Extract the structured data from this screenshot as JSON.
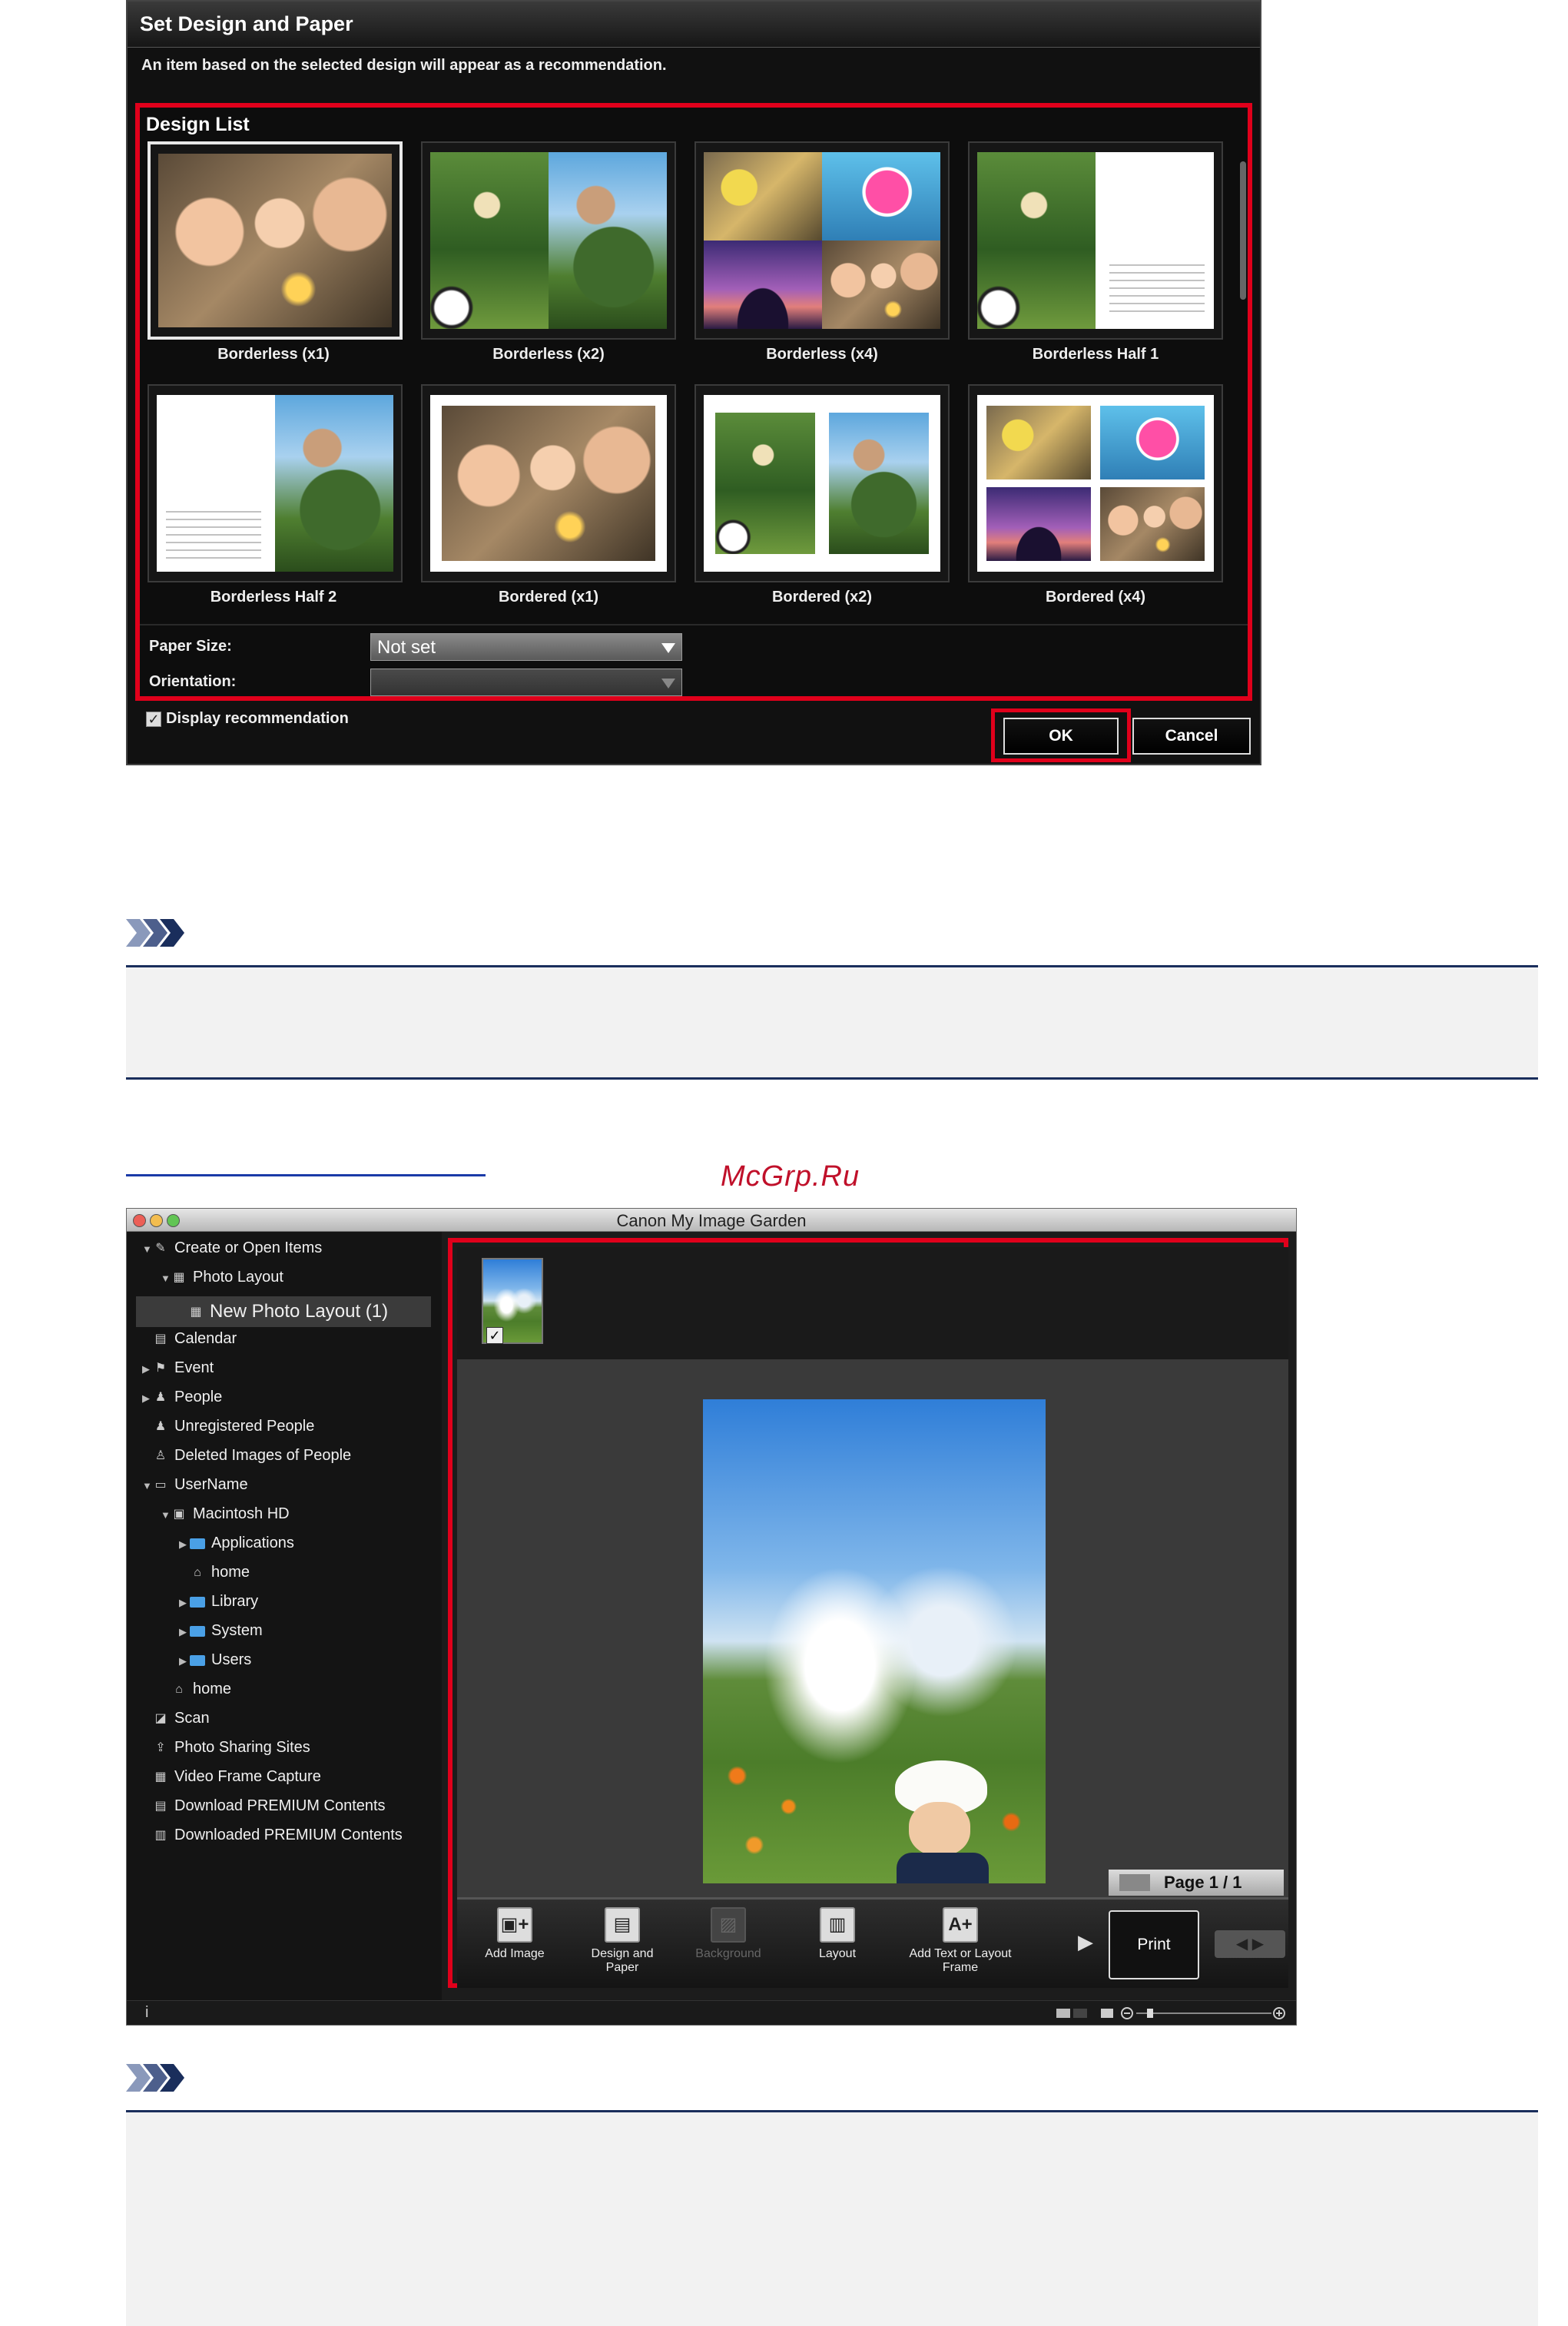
{
  "dialog": {
    "title": "Set Design and Paper",
    "description": "An item based on the selected design will appear as a recommendation.",
    "design_list_label": "Design List",
    "designs": [
      "Borderless (x1)",
      "Borderless (x2)",
      "Borderless (x4)",
      "Borderless Half 1",
      "Borderless Half 2",
      "Bordered (x1)",
      "Bordered (x2)",
      "Bordered (x4)"
    ],
    "selected_design": "Borderless (x1)",
    "paper_size_label": "Paper Size:",
    "paper_size_value": "Not set",
    "orientation_label": "Orientation:",
    "orientation_value": "",
    "display_recommendation_label": "Display recommendation",
    "display_recommendation_checked": true,
    "ok_label": "OK",
    "cancel_label": "Cancel",
    "highlight_color": "#e0001b"
  },
  "watermark": "McGrp.Ru",
  "app": {
    "title": "Canon My Image Garden",
    "tree": [
      {
        "label": "Create or Open Items",
        "icon": "edit-icon",
        "expanded": true
      },
      {
        "label": "Photo Layout",
        "icon": "layout-icon",
        "expanded": true
      },
      {
        "label": "New Photo Layout (1)",
        "icon": "layout-icon",
        "selected": true
      },
      {
        "label": "Calendar",
        "icon": "calendar-icon"
      },
      {
        "label": "Event",
        "icon": "event-icon",
        "collapsed": true
      },
      {
        "label": "People",
        "icon": "person-icon",
        "collapsed": true
      },
      {
        "label": "Unregistered People",
        "icon": "person-icon"
      },
      {
        "label": "Deleted Images of People",
        "icon": "person-outline-icon"
      },
      {
        "label": "UserName",
        "icon": "computer-icon",
        "expanded": true
      },
      {
        "label": "Macintosh HD",
        "icon": "disk-icon",
        "expanded": true
      },
      {
        "label": "Applications",
        "icon": "folder-icon",
        "collapsed": true
      },
      {
        "label": "home",
        "icon": "home-icon"
      },
      {
        "label": "Library",
        "icon": "folder-icon",
        "collapsed": true
      },
      {
        "label": "System",
        "icon": "folder-icon",
        "collapsed": true
      },
      {
        "label": "Users",
        "icon": "folder-icon",
        "collapsed": true
      },
      {
        "label": "home",
        "icon": "home-icon"
      },
      {
        "label": "Scan",
        "icon": "scan-icon"
      },
      {
        "label": "Photo Sharing Sites",
        "icon": "share-icon"
      },
      {
        "label": "Video Frame Capture",
        "icon": "video-icon"
      },
      {
        "label": "Download PREMIUM Contents",
        "icon": "download-icon"
      },
      {
        "label": "Downloaded PREMIUM Contents",
        "icon": "folder-icon"
      }
    ],
    "page_indicator": "Page 1 / 1",
    "toolbar": {
      "add_image": "Add Image",
      "design_and_paper": "Design and Paper",
      "background": "Background",
      "layout": "Layout",
      "add_text": "Add Text or Layout Frame",
      "print": "Print"
    },
    "thumb_checked": true
  }
}
